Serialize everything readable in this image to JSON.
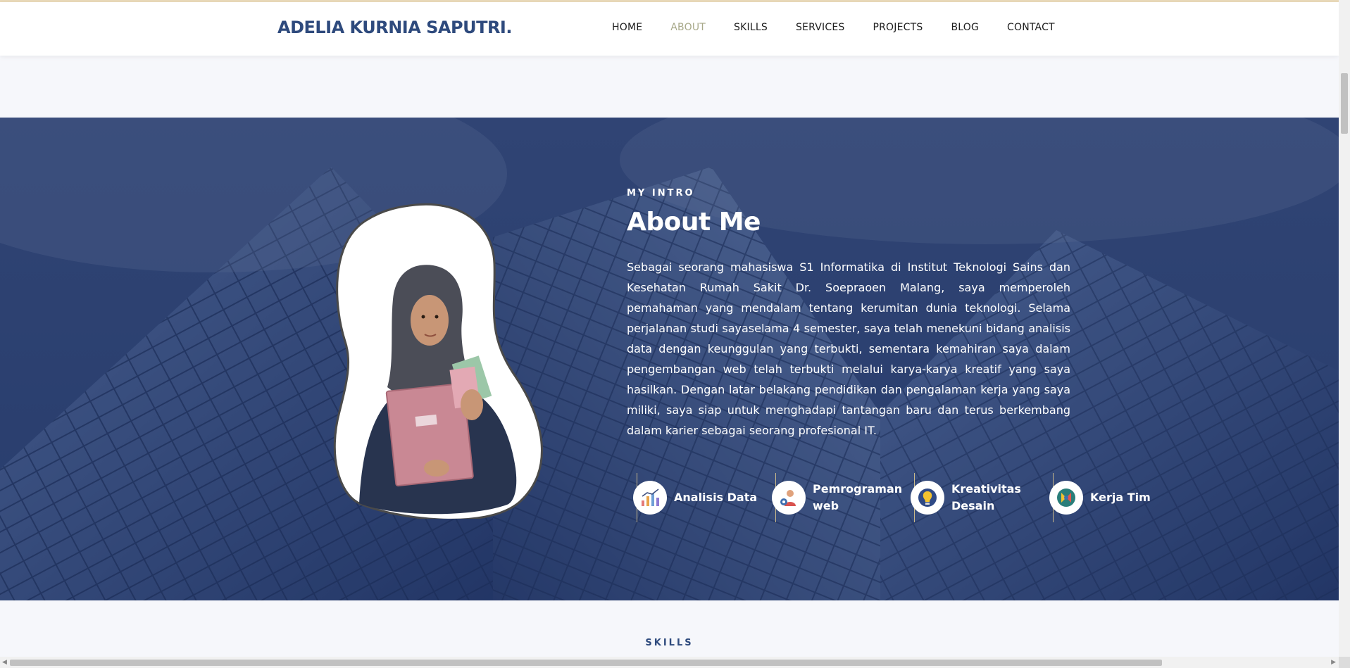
{
  "header": {
    "brand": "ADELIA KURNIA SAPUTRI.",
    "nav": [
      "HOME",
      "ABOUT",
      "SKILLS",
      "SERVICES",
      "PROJECTS",
      "BLOG",
      "CONTACT"
    ],
    "active": "ABOUT"
  },
  "about": {
    "label": "MY INTRO",
    "title": "About Me",
    "text": "Sebagai seorang mahasiswa S1 Informatika di Institut Teknologi Sains dan Kesehatan Rumah Sakit Dr. Soepraoen Malang, saya memperoleh pemahaman yang mendalam tentang kerumitan dunia teknologi. Selama perjalanan studi sayaselama 4 semester, saya telah menekuni bidang analisis data dengan keunggulan yang terbukti, sementara kemahiran saya dalam pengembangan web telah terbukti melalui karya-karya kreatif yang saya hasilkan. Dengan latar belakang pendidikan dan pengalaman kerja yang saya miliki, saya siap untuk menghadapi tantangan baru dan terus berkembang dalam karier sebagai seorang profesional IT.",
    "skills": [
      {
        "label": "Analisis Data",
        "icon": "analytics-icon"
      },
      {
        "label": "Pemrograman web",
        "icon": "programmer-icon"
      },
      {
        "label": "Kreativitas Desain",
        "icon": "idea-bulb-icon"
      },
      {
        "label": "Kerja Tim",
        "icon": "teamwork-icon"
      }
    ]
  },
  "next_section": {
    "label": "SKILLS"
  },
  "colors": {
    "brand": "#2e4a7d",
    "nav_active": "#a8a98a",
    "hero_bg": "#34497a",
    "accent_line": "#c9b98a"
  }
}
